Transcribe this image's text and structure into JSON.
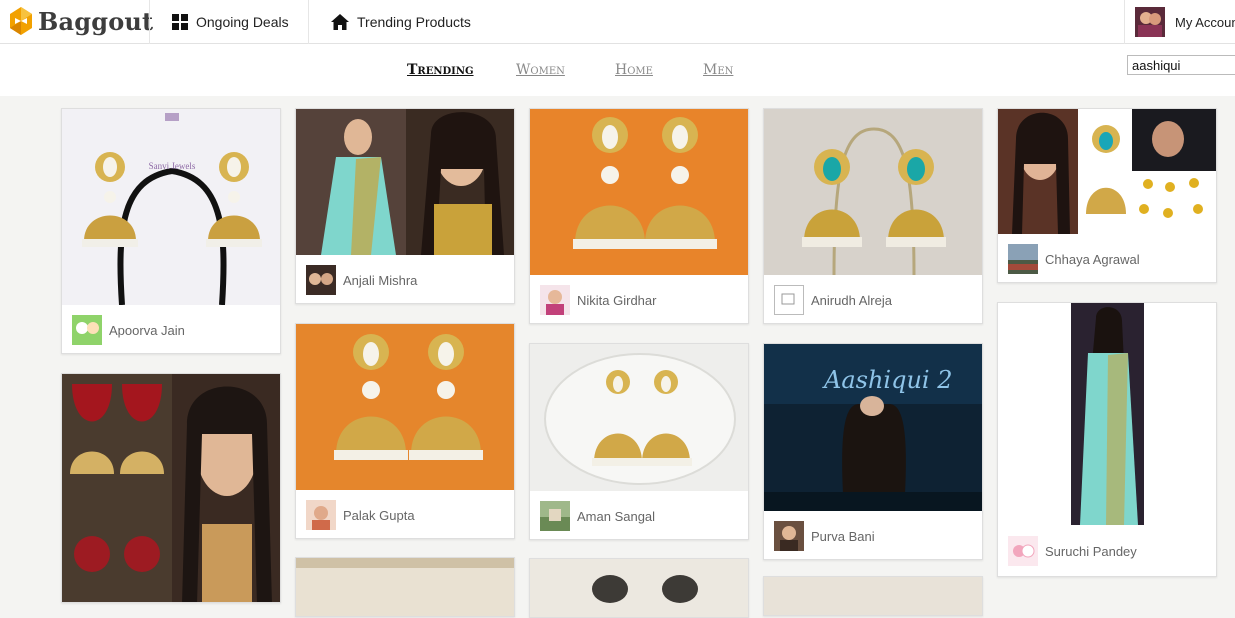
{
  "header": {
    "logo_text": "Baggout",
    "nav": [
      {
        "label": "Ongoing Deals",
        "icon": "grid-icon"
      },
      {
        "label": "Trending Products",
        "icon": "home-icon"
      }
    ],
    "account_label": "My Account"
  },
  "categories": [
    {
      "label": "Trending",
      "active": true
    },
    {
      "label": "Women",
      "active": false
    },
    {
      "label": "Home",
      "active": false
    },
    {
      "label": "Men",
      "active": false
    }
  ],
  "search": {
    "value": "aashiqui"
  },
  "cards": [
    {
      "user": "Apoorva Jain",
      "image": "jhumka-earrings-on-stand",
      "watermark": "Sanvi Jewels"
    },
    {
      "user": "Anjali Mishra",
      "image": "actress-in-turquoise-saree"
    },
    {
      "user": "Nikita Girdhar",
      "image": "pearl-jhumka-earrings"
    },
    {
      "user": "Anirudh Alreja",
      "image": "turquoise-jhumka-earrings"
    },
    {
      "user": "Chhaya Agrawal",
      "image": "earrings-collage"
    },
    {
      "user": "Palak Gupta",
      "image": "pearl-jhumka-earrings"
    },
    {
      "user": "Aman Sangal",
      "image": "jhumka-earrings-on-lace"
    },
    {
      "user": "Purva Bani",
      "image": "aashiqui-2-movie-poster",
      "poster_title": "Aashiqui 2"
    },
    {
      "user": "Suruchi Pandey",
      "image": "actress-turquoise-saree-full"
    },
    {
      "user": "",
      "image": "red-stone-jhumka-collage"
    }
  ],
  "colors": {
    "logo_orange": "#f2a100",
    "turquoise": "#7fd6cc",
    "gold": "#c9a23a",
    "background": "#f4f4f2"
  }
}
